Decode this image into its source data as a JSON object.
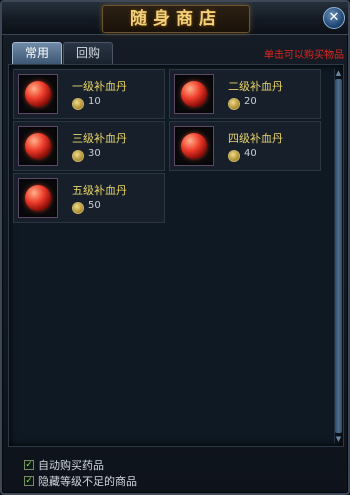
{
  "window": {
    "title": "随身商店",
    "close_label": "✕"
  },
  "tabs": [
    {
      "label": "常用",
      "active": true
    },
    {
      "label": "回购",
      "active": false
    }
  ],
  "hint": "单击可以购买物品",
  "items": [
    {
      "name": "一级补血丹",
      "price": "10",
      "icon": "red-potion-orb-icon"
    },
    {
      "name": "二级补血丹",
      "price": "20",
      "icon": "red-potion-orb-icon"
    },
    {
      "name": "三级补血丹",
      "price": "30",
      "icon": "red-potion-orb-icon"
    },
    {
      "name": "四级补血丹",
      "price": "40",
      "icon": "red-potion-orb-icon"
    },
    {
      "name": "五级补血丹",
      "price": "50",
      "icon": "red-potion-orb-icon"
    }
  ],
  "options": [
    {
      "label": "自动购买药品",
      "checked": true
    },
    {
      "label": "隐藏等级不足的商品",
      "checked": true
    }
  ],
  "colors": {
    "title": "#f2d27a",
    "item_name": "#e8d46a",
    "hint": "#e0271e",
    "checkmark": "#7fdc54"
  }
}
